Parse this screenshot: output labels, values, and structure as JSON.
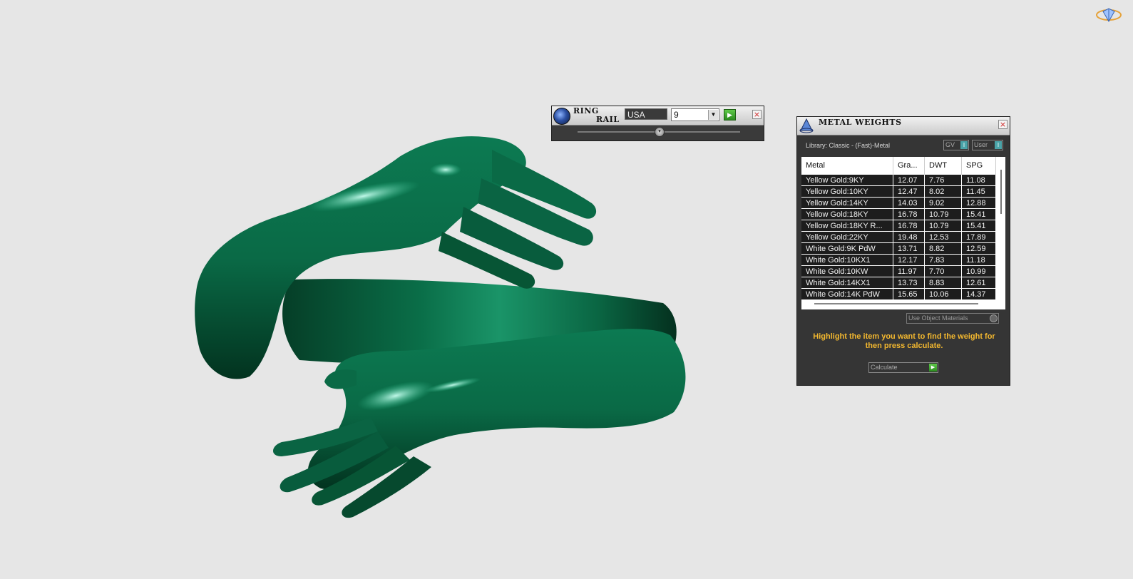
{
  "ring_rail": {
    "title_line1": "RING",
    "title_line2": "RAIL",
    "country": "USA",
    "size": "9"
  },
  "metal_weights": {
    "title": "METAL WEIGHTS",
    "library": "Library: Classic - (Fast)-Metal",
    "toggle_gv": "GV",
    "toggle_user": "User",
    "columns": [
      "Metal",
      "Gra...",
      "DWT",
      "SPG"
    ],
    "rows": [
      [
        "Yellow Gold:9KY",
        "12.07",
        "7.76",
        "11.08"
      ],
      [
        "Yellow Gold:10KY",
        "12.47",
        "8.02",
        "11.45"
      ],
      [
        "Yellow Gold:14KY",
        "14.03",
        "9.02",
        "12.88"
      ],
      [
        "Yellow Gold:18KY",
        "16.78",
        "10.79",
        "15.41"
      ],
      [
        "Yellow Gold:18KY R...",
        "16.78",
        "10.79",
        "15.41"
      ],
      [
        "Yellow Gold:22KY",
        "19.48",
        "12.53",
        "17.89"
      ],
      [
        "White Gold:9K PdW",
        "13.71",
        "8.82",
        "12.59"
      ],
      [
        "White Gold:10KX1",
        "12.17",
        "7.83",
        "11.18"
      ],
      [
        "White Gold:10KW",
        "11.97",
        "7.70",
        "10.99"
      ],
      [
        "White Gold:14KX1",
        "13.73",
        "8.83",
        "12.61"
      ],
      [
        "White Gold:14K PdW",
        "15.65",
        "10.06",
        "14.37"
      ]
    ],
    "use_object_materials": "Use Object Materials",
    "instruction": "Highlight the item you want to find the weight for then press calculate.",
    "calculate": "Calculate"
  },
  "colors": {
    "background": "#e6e6e6",
    "model_green": "#0f7a4f",
    "instruction_text": "#f2b72f",
    "panel_bg": "#353535"
  },
  "icons": [
    "view-navigation-icon",
    "ring-rail-logo-icon",
    "metal-weights-logo-icon",
    "close-icon",
    "play-icon",
    "chevron-down-icon"
  ]
}
